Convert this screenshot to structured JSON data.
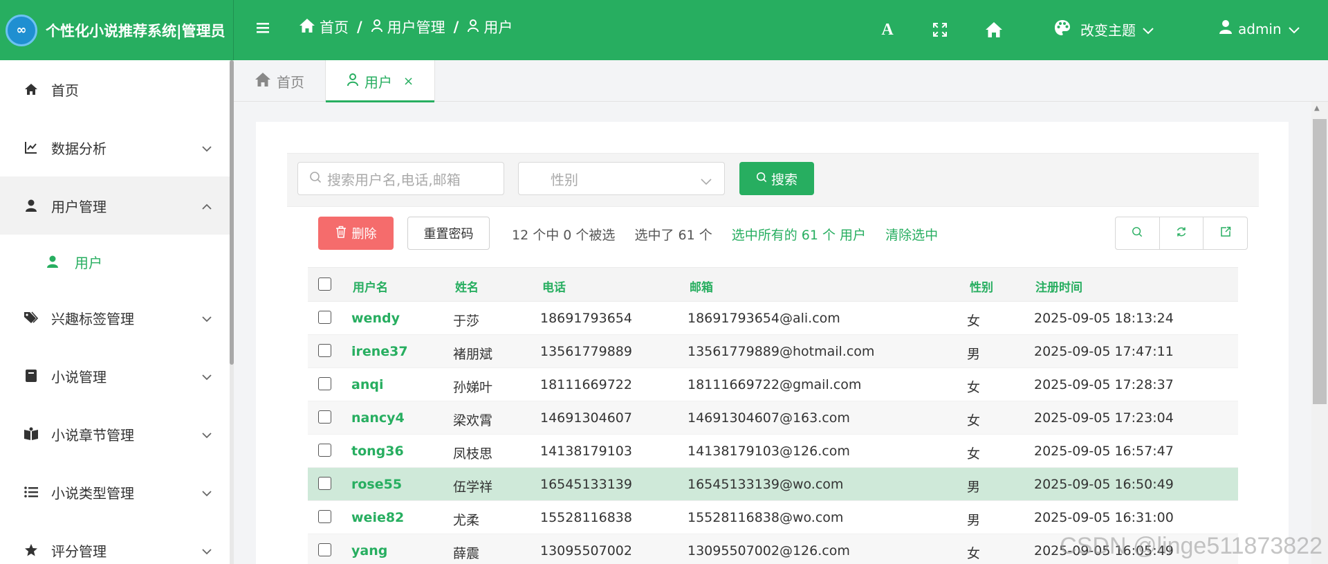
{
  "brand": {
    "logo_text": "∞",
    "title": "个性化小说推荐系统|管理员"
  },
  "sidebar": {
    "items": [
      {
        "label": "首页",
        "icon": "home-icon"
      },
      {
        "label": "数据分析",
        "icon": "chart-line-icon"
      },
      {
        "label": "用户管理",
        "icon": "user-icon"
      },
      {
        "label": "用户",
        "icon": "user-icon"
      },
      {
        "label": "兴趣标签管理",
        "icon": "tags-icon"
      },
      {
        "label": "小说管理",
        "icon": "book-icon"
      },
      {
        "label": "小说章节管理",
        "icon": "book-open-icon"
      },
      {
        "label": "小说类型管理",
        "icon": "list-icon"
      },
      {
        "label": "评分管理",
        "icon": "star-icon"
      }
    ]
  },
  "header": {
    "breadcrumbs": [
      "首页",
      "用户管理",
      "用户"
    ],
    "separator": "/",
    "font_icon_label": "A",
    "theme_label": "改变主题",
    "user_label": "admin"
  },
  "tabs": [
    {
      "label": "首页",
      "active": false
    },
    {
      "label": "用户",
      "active": true,
      "close": "×"
    }
  ],
  "search": {
    "placeholder": "搜索用户名,电话,邮箱",
    "gender_placeholder": "性别",
    "button_label": "搜索"
  },
  "actions": {
    "delete_label": "删除",
    "reset_label": "重置密码",
    "count_text": "12 个中 0 个被选",
    "selected_text": "选中了 61 个",
    "select_all_text": "选中所有的 61 个 用户",
    "clear_text": "清除选中"
  },
  "table": {
    "columns": [
      "用户名",
      "姓名",
      "电话",
      "邮箱",
      "性别",
      "注册时间"
    ],
    "rows": [
      [
        "wendy",
        "于莎",
        "18691793654",
        "18691793654@ali.com",
        "女",
        "2025-09-05 18:13:24"
      ],
      [
        "irene37",
        "褚朋斌",
        "13561779889",
        "13561779889@hotmail.com",
        "男",
        "2025-09-05 17:47:11"
      ],
      [
        "anqi",
        "孙娣叶",
        "18111669722",
        "18111669722@gmail.com",
        "女",
        "2025-09-05 17:28:37"
      ],
      [
        "nancy4",
        "梁欢霄",
        "14691304607",
        "14691304607@163.com",
        "女",
        "2025-09-05 17:23:04"
      ],
      [
        "tong36",
        "凤枝思",
        "14138179103",
        "14138179103@126.com",
        "女",
        "2025-09-05 16:57:47"
      ],
      [
        "rose55",
        "伍学祥",
        "16545133139",
        "16545133139@wo.com",
        "男",
        "2025-09-05 16:50:49"
      ],
      [
        "weie82",
        "尤柔",
        "15528116838",
        "15528116838@wo.com",
        "男",
        "2025-09-05 16:31:00"
      ],
      [
        "yang",
        "薛震",
        "13095507002",
        "13095507002@126.com",
        "女",
        "2025-09-05 16:05:49"
      ]
    ],
    "highlight_row": 5
  },
  "watermark": "CSDN @linge511873822",
  "colors": {
    "primary": "#27ae60",
    "danger": "#f56c6c",
    "highlight": "#cfe9d9"
  }
}
